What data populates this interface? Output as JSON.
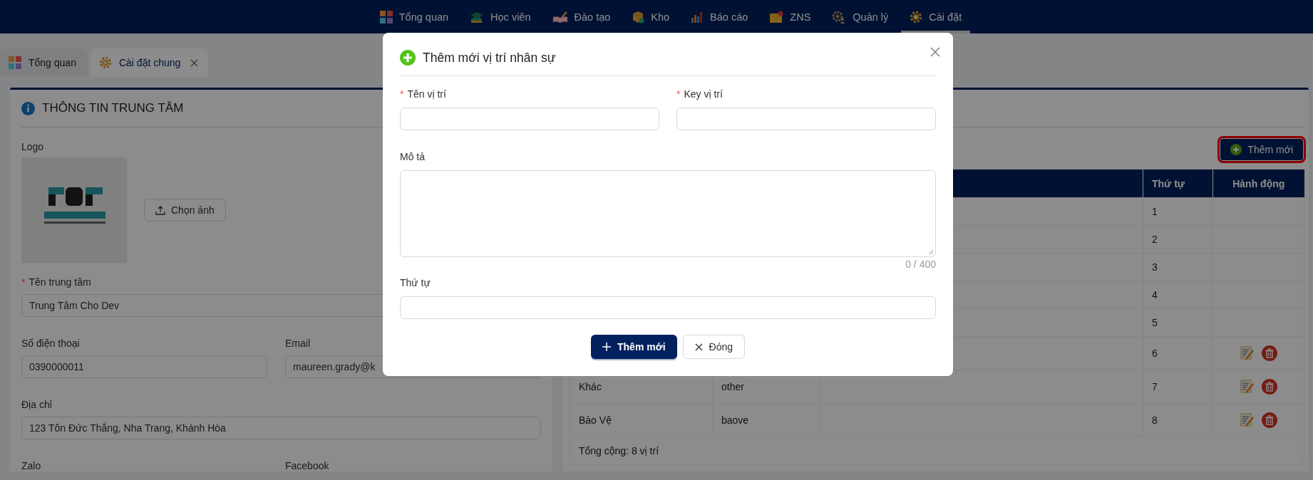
{
  "nav": {
    "items": [
      {
        "label": "Tổng quan",
        "selected": false
      },
      {
        "label": "Học viên",
        "selected": false
      },
      {
        "label": "Đào tạo",
        "selected": false
      },
      {
        "label": "Kho",
        "selected": false
      },
      {
        "label": "Báo cáo",
        "selected": false
      },
      {
        "label": "ZNS",
        "selected": false
      },
      {
        "label": "Quản lý",
        "selected": false
      },
      {
        "label": "Cài đặt",
        "selected": true
      }
    ]
  },
  "tabs": [
    {
      "label": "Tổng quan",
      "selected": false,
      "closable": false
    },
    {
      "label": "Cài đặt chung",
      "selected": true,
      "closable": true
    }
  ],
  "center_info": {
    "title": "THÔNG TIN TRUNG TÂM",
    "logo": {
      "label": "Logo",
      "kind": "picture",
      "upload_button": "Chọn ảnh"
    },
    "field_rows": [
      [
        {
          "label": "Tên trung tâm",
          "required_mark": "*",
          "value": "Trung Tâm Cho Dev"
        }
      ],
      [
        {
          "label": "Số điện thoại",
          "value": "0390000011"
        },
        {
          "label": "Email",
          "value": "maureen.grady@k"
        }
      ],
      [
        {
          "label": "Địa chỉ",
          "value": "123 Tôn Đức Thắng, Nha Trang, Khánh Hòa"
        }
      ],
      [
        {
          "label": "Zalo"
        },
        {
          "label": "Facebook"
        }
      ]
    ]
  },
  "positions": {
    "add_button": {
      "label": "Thêm mới",
      "highlighted": true
    },
    "table": {
      "columns": [
        "Thứ tự",
        "Hành động"
      ],
      "rows": [
        {
          "order": "1",
          "actions": false
        },
        {
          "order": "2",
          "actions": false
        },
        {
          "order": "3",
          "actions": false
        },
        {
          "order": "4",
          "actions": false
        },
        {
          "order": "5",
          "actions": false
        },
        {
          "order": "6",
          "actions": true
        },
        {
          "name": "Khác",
          "key": "other",
          "order": "7",
          "actions": true
        },
        {
          "name": "Bảo Vệ",
          "key": "baove",
          "order": "8",
          "actions": true
        }
      ],
      "footer": "Tổng cộng: 8 vị trí"
    }
  },
  "dialog": {
    "title": "Thêm mới vị trí nhân sự",
    "fields": [
      {
        "label": "Tên vị trí",
        "required_mark": "*",
        "kind": "input"
      },
      {
        "label": "Key vị trí",
        "required_mark": "*",
        "kind": "input"
      },
      {
        "label": "Mô tả",
        "kind": "textarea",
        "counter": "0 / 400"
      },
      {
        "label": "Thứ tự",
        "kind": "input"
      }
    ],
    "buttons": [
      {
        "label": "Thêm mới",
        "kind": "primary"
      },
      {
        "label": "Đóng",
        "kind": "default"
      }
    ]
  }
}
